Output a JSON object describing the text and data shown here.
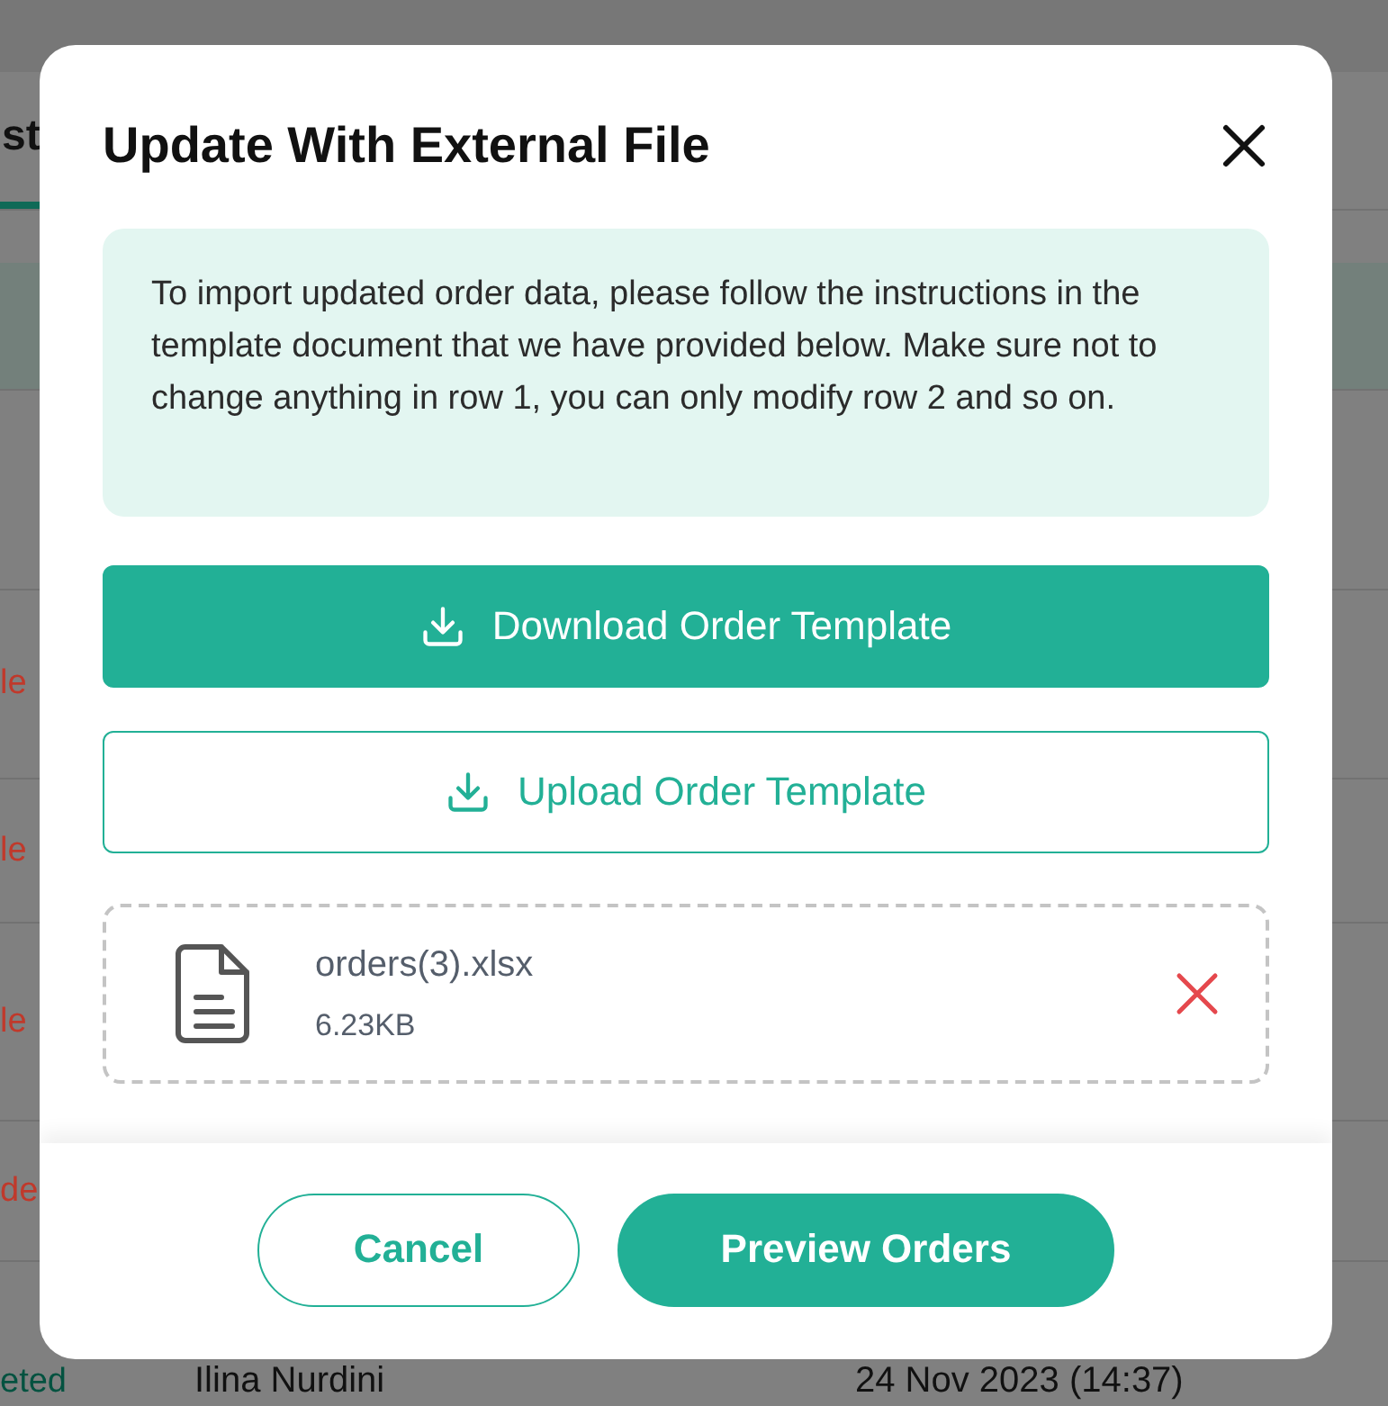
{
  "background": {
    "tab": {
      "label": "st",
      "selected": true
    },
    "rows": [
      {
        "status": "le",
        "color": "#c0392b"
      },
      {
        "status": "le",
        "color": "#c0392b"
      },
      {
        "status": "le",
        "color": "#c0392b"
      },
      {
        "status": "de",
        "color": "#c0392b"
      },
      {
        "status": "eted",
        "color": "#035240",
        "name": "Ilina Nurdini",
        "date": "24 Nov 2023 (14:37)"
      }
    ]
  },
  "dialog": {
    "title": "Update With External File",
    "info": "To import updated order data, please follow the instructions in the template document that we have provided below. Make sure not to change anything in row 1, you can only modify row 2 and so on.",
    "download_button": "Download Order Template",
    "upload_button": "Upload Order Template",
    "file": {
      "name": "orders(3).xlsx",
      "size": "6.23KB"
    },
    "buttons": [
      {
        "label": "Cancel",
        "kind": "secondary"
      },
      {
        "label": "Preview Orders",
        "kind": "primary"
      }
    ]
  }
}
